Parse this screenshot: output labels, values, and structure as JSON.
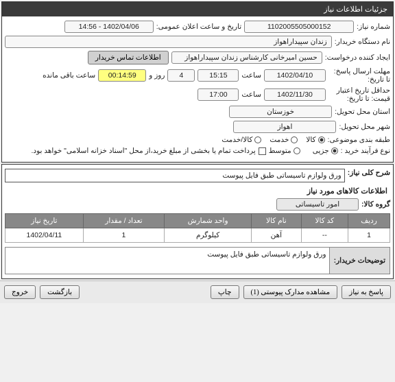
{
  "header": {
    "title": "جزئیات اطلاعات نیاز"
  },
  "fields": {
    "needNumberLabel": "شماره نیاز:",
    "needNumber": "1102005505000152",
    "publicDateLabel": "تاریخ و ساعت اعلان عمومی:",
    "publicDate": "1402/04/06 - 14:56",
    "buyerOrgLabel": "نام دستگاه خریدار:",
    "buyerOrg": "زندان سپیداراهواز",
    "requesterLabel": "ایجاد کننده درخواست:",
    "requester": "حسین امیرخانی کارشناس زندان سپیداراهواز",
    "contactBtn": "اطلاعات تماس خریدار",
    "answerDeadlineLabel": "مهلت ارسال پاسخ: تا تاریخ:",
    "answerDate": "1402/04/10",
    "saatLabel": "ساعت",
    "answerTime": "15:15",
    "rozLabel": "روز و",
    "daysRemain": "4",
    "remainTime": "00:14:59",
    "remainLabel": "ساعت باقی مانده",
    "validDeadlineLabel": "حداقل تاریخ اعتبار قیمت: تا تاریخ:",
    "validDate": "1402/11/30",
    "validTime": "17:00",
    "provinceLabel": "استان محل تحویل:",
    "province": "خوزستان",
    "cityLabel": "شهر محل تحویل:",
    "city": "اهواز",
    "categoryLabel": "طبقه بندی موضوعی:",
    "kala": "کالا",
    "khedmat": "خدمت",
    "kalaKhedmat": "کالا/خدمت",
    "buyTypeLabel": "نوع فرآیند خرید :",
    "jozi": "جزیی",
    "motavaset": "متوسط",
    "note": "پرداخت تمام یا بخشی از مبلغ خرید،از محل \"اسناد خزانه اسلامی\" خواهد بود.",
    "descLabel": "شرح کلی نیاز:",
    "descValue": "ورق ولوازم تاسیساتی طبق فایل پیوست",
    "itemsTitle": "اطلاعات کالاهای مورد نیاز",
    "groupLabel": "گروه کالا:",
    "groupValue": "امور تاسیساتی",
    "buyerNotesLabel": "توضیحات خریدار:",
    "buyerNotesValue": "ورق ولوازم تاسیساتی طبق فایل پیوست"
  },
  "tableHeaders": {
    "row": "ردیف",
    "code": "کد کالا",
    "name": "نام کالا",
    "unit": "واحد شمارش",
    "qty": "تعداد / مقدار",
    "date": "تاریخ نیاز"
  },
  "items": [
    {
      "row": "1",
      "code": "--",
      "name": "آهن",
      "unit": "کیلوگرم",
      "qty": "1",
      "date": "1402/04/11"
    }
  ],
  "footer": {
    "reply": "پاسخ به نیاز",
    "attachments": "مشاهده مدارک پیوستی (1)",
    "print": "چاپ",
    "back": "بازگشت",
    "exit": "خروج"
  }
}
